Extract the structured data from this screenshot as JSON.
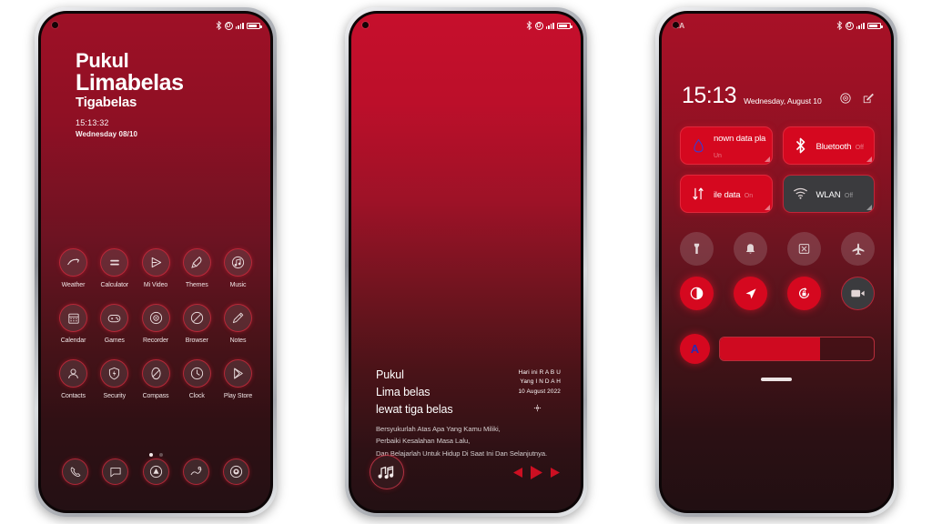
{
  "phone1": {
    "statusbar": {
      "carrier": "",
      "icons": [
        "bluetooth-icon",
        "vo-lte-icon",
        "signal-bars-icon",
        "battery-icon"
      ]
    },
    "clock": {
      "line1": "Pukul",
      "line2": "Limabelas",
      "line3": "Tigabelas",
      "time": "15:13:32",
      "date": "Wednesday 08/10"
    },
    "apps": [
      [
        {
          "label": "Weather",
          "icon": "weather-icon"
        },
        {
          "label": "Calculator",
          "icon": "calculator-icon"
        },
        {
          "label": "Mi Video",
          "icon": "video-play-icon"
        },
        {
          "label": "Themes",
          "icon": "themes-icon"
        },
        {
          "label": "Music",
          "icon": "music-note-icon"
        }
      ],
      [
        {
          "label": "Calendar",
          "icon": "calendar-icon"
        },
        {
          "label": "Games",
          "icon": "gamepad-icon"
        },
        {
          "label": "Recorder",
          "icon": "recorder-icon"
        },
        {
          "label": "Browser",
          "icon": "browser-icon"
        },
        {
          "label": "Notes",
          "icon": "pencil-notes-icon"
        }
      ],
      [
        {
          "label": "Contacts",
          "icon": "contacts-icon"
        },
        {
          "label": "Security",
          "icon": "shield-icon"
        },
        {
          "label": "Compass",
          "icon": "compass-icon"
        },
        {
          "label": "Clock",
          "icon": "clock-icon"
        },
        {
          "label": "Play Store",
          "icon": "play-store-icon"
        }
      ]
    ],
    "dock": [
      {
        "label": "Phone",
        "icon": "phone-icon"
      },
      {
        "label": "Messages",
        "icon": "message-icon"
      },
      {
        "label": "Apps",
        "icon": "app-drawer-icon"
      },
      {
        "label": "Gallery",
        "icon": "gallery-icon"
      },
      {
        "label": "Camera",
        "icon": "camera-icon"
      }
    ],
    "pages": {
      "count": 2,
      "active": 1
    }
  },
  "phone2": {
    "statusbar": {
      "icons": [
        "bluetooth-icon",
        "vo-lte-icon",
        "signal-bars-icon",
        "battery-icon"
      ]
    },
    "lyrics": {
      "line1": "Pukul",
      "line2": "Lima belas",
      "line3": "lewat tiga belas"
    },
    "hari": {
      "line1": "Hari ini R A B U",
      "line2": "Yang I N D A H",
      "line3": "10 August 2022"
    },
    "quote": {
      "line1": "Bersyukurlah Atas Apa Yang Kamu Miliki,",
      "line2": "Perbaiki Kesalahan Masa Lalu,",
      "line3": "Dan Belajarlah Untuk Hidup Di Saat Ini Dan Selanjutnya."
    },
    "music": {
      "icon": "music-notes-icon",
      "controls": [
        "previous-icon",
        "play-icon",
        "next-icon"
      ],
      "accent": "#cc0f22"
    },
    "settings_icon": "gear-icon"
  },
  "phone3": {
    "statusbar": {
      "carrier": "EA",
      "icons": [
        "bluetooth-icon",
        "vo-lte-icon",
        "signal-bars-icon",
        "battery-icon"
      ]
    },
    "header": {
      "time": "15:13",
      "date": "Wednesday, August 10",
      "icons": [
        "settings-gear-icon",
        "edit-icon"
      ]
    },
    "tiles": [
      [
        {
          "name": "nown data pla",
          "sub": "Un",
          "icon": "water-drop-icon",
          "state": "on"
        },
        {
          "name": "Bluetooth",
          "sub": "Off",
          "icon": "bluetooth-icon",
          "state": "on"
        }
      ],
      [
        {
          "name": "ile data",
          "sub": "On",
          "icon": "mobile-data-icon",
          "state": "on"
        },
        {
          "name": "WLAN",
          "sub": "Off",
          "icon": "wifi-icon",
          "state": "off"
        }
      ]
    ],
    "toggles": [
      [
        {
          "name": "Flashlight",
          "icon": "flashlight-icon",
          "state": "dim"
        },
        {
          "name": "Silent",
          "icon": "bell-icon",
          "state": "dim"
        },
        {
          "name": "Screenshot",
          "icon": "screenshot-icon",
          "state": "dim"
        },
        {
          "name": "Airplane mode",
          "icon": "airplane-icon",
          "state": "dim"
        }
      ],
      [
        {
          "name": "Dark mode",
          "icon": "dark-mode-icon",
          "state": "on"
        },
        {
          "name": "Location",
          "icon": "location-arrow-icon",
          "state": "on"
        },
        {
          "name": "Auto-rotate",
          "icon": "rotate-lock-icon",
          "state": "on"
        },
        {
          "name": "Screen recorder",
          "icon": "video-camera-icon",
          "state": "dark"
        }
      ]
    ],
    "brightness": {
      "auto_label": "A",
      "value": 65
    },
    "accent": "#d5081f"
  }
}
